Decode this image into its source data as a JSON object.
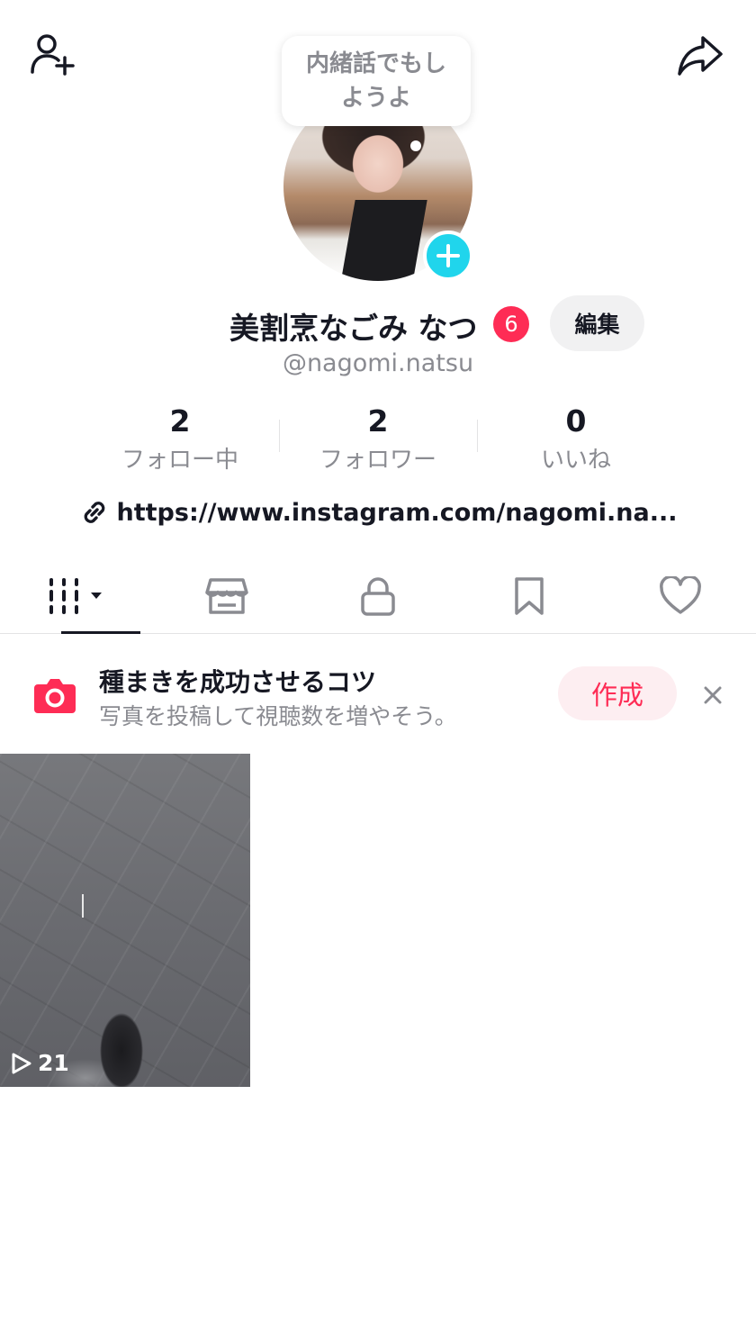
{
  "header": {
    "add_friend_icon": "add-user-icon",
    "share_icon": "share-arrow-icon"
  },
  "bubble": {
    "text": "内緒話でもしようよ"
  },
  "profile": {
    "name": "美割烹なごみ なつ",
    "badge_count": "6",
    "edit_label": "編集",
    "handle": "@nagomi.natsu",
    "link": "https://www.instagram.com/nagomi.na..."
  },
  "stats": [
    {
      "value": "2",
      "label": "フォロー中"
    },
    {
      "value": "2",
      "label": "フォロワー"
    },
    {
      "value": "0",
      "label": "いいね"
    }
  ],
  "tabs": [
    {
      "name": "videos",
      "icon": "grid-lines-icon",
      "active": true
    },
    {
      "name": "shop",
      "icon": "shop-icon",
      "active": false
    },
    {
      "name": "private",
      "icon": "lock-icon",
      "active": false
    },
    {
      "name": "saved",
      "icon": "bookmark-icon",
      "active": false
    },
    {
      "name": "liked",
      "icon": "heart-icon",
      "active": false
    }
  ],
  "tip": {
    "title": "種まきを成功させるコツ",
    "subtitle": "写真を投稿して視聴数を増やそう。",
    "create_label": "作成",
    "close_icon": "close-icon"
  },
  "videos": [
    {
      "views": "21"
    }
  ],
  "colors": {
    "accent": "#fe2c55",
    "avatar_plus": "#20d5ec",
    "text_primary": "#161823",
    "text_secondary": "#8a8b91"
  }
}
